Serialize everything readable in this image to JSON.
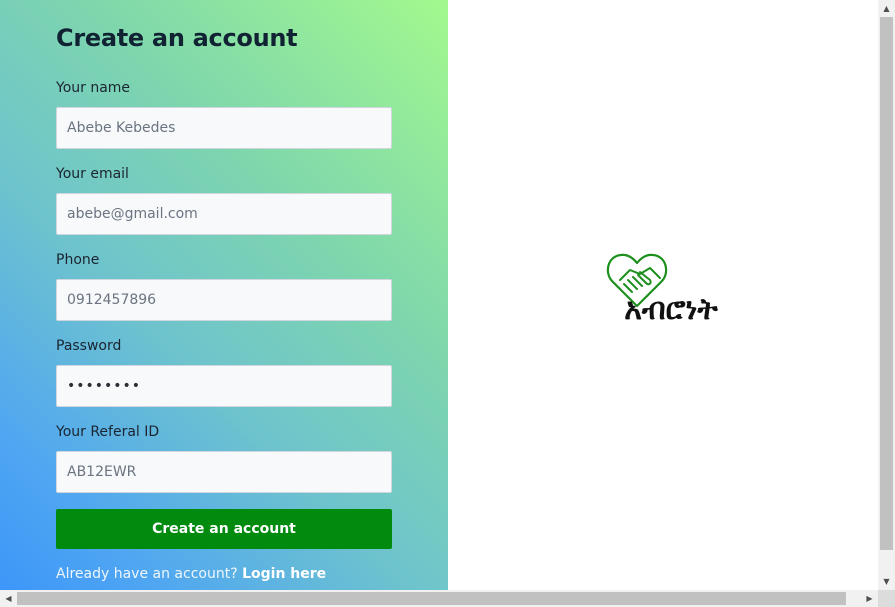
{
  "form": {
    "title": "Create an account",
    "fields": [
      {
        "label": "Your name",
        "value": "Abebe Kebedes"
      },
      {
        "label": "Your email",
        "value": "abebe@gmail.com"
      },
      {
        "label": "Phone",
        "value": "0912457896"
      },
      {
        "label": "Password",
        "value": "••••••••"
      },
      {
        "label": "Your Referal ID",
        "value": "AB12EWR"
      }
    ],
    "submit_label": "Create an account",
    "login_prompt": "Already have an account?",
    "login_link": "Login here"
  },
  "logo": {
    "text": "አብሮነት",
    "icon": "handshake-heart-icon"
  },
  "colors": {
    "button": "#008a0e",
    "logo_green": "#1d8f1d",
    "gradient_top_right": "#a3f98d",
    "gradient_bottom_left": "#3d96f8"
  }
}
